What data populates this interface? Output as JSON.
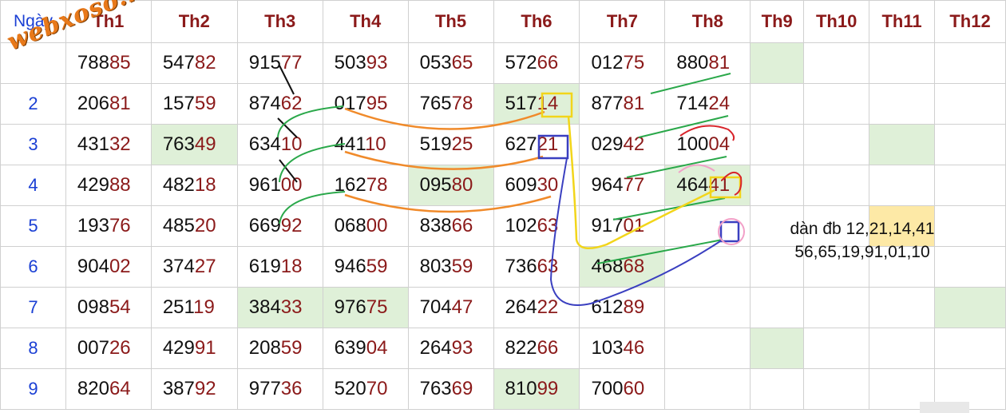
{
  "watermark": "webxoso.net",
  "header": {
    "day_label": "Ngày",
    "columns": [
      "Th1",
      "Th2",
      "Th3",
      "Th4",
      "Th5",
      "Th6",
      "Th7",
      "Th8",
      "Th9",
      "Th10",
      "Th11",
      "Th12"
    ]
  },
  "rows": [
    {
      "day": "",
      "cells": [
        [
          "788",
          "85"
        ],
        [
          "547",
          "82"
        ],
        [
          "915",
          "77"
        ],
        [
          "503",
          "93"
        ],
        [
          "053",
          "65"
        ],
        [
          "572",
          "66"
        ],
        [
          "012",
          "75"
        ],
        [
          "880",
          "81"
        ],
        null,
        null,
        null,
        null
      ]
    },
    {
      "day": "2",
      "cells": [
        [
          "206",
          "81"
        ],
        [
          "157",
          "59"
        ],
        [
          "874",
          "62"
        ],
        [
          "017",
          "95"
        ],
        [
          "765",
          "78"
        ],
        [
          "517",
          "14"
        ],
        [
          "877",
          "81"
        ],
        [
          "714",
          "24"
        ],
        null,
        null,
        null,
        null
      ]
    },
    {
      "day": "3",
      "cells": [
        [
          "431",
          "32"
        ],
        [
          "763",
          "49"
        ],
        [
          "634",
          "10"
        ],
        [
          "441",
          "10"
        ],
        [
          "519",
          "25"
        ],
        [
          "627",
          "21"
        ],
        [
          "029",
          "42"
        ],
        [
          "100",
          "04"
        ],
        null,
        null,
        null,
        null
      ]
    },
    {
      "day": "4",
      "cells": [
        [
          "429",
          "88"
        ],
        [
          "482",
          "18"
        ],
        [
          "961",
          "00"
        ],
        [
          "162",
          "78"
        ],
        [
          "095",
          "80"
        ],
        [
          "609",
          "30"
        ],
        [
          "964",
          "77"
        ],
        [
          "464",
          "41"
        ],
        null,
        null,
        null,
        null
      ]
    },
    {
      "day": "5",
      "cells": [
        [
          "193",
          "76"
        ],
        [
          "485",
          "20"
        ],
        [
          "669",
          "92"
        ],
        [
          "068",
          "00"
        ],
        [
          "838",
          "66"
        ],
        [
          "102",
          "63"
        ],
        [
          "917",
          "01"
        ],
        null,
        null,
        null,
        null,
        null
      ]
    },
    {
      "day": "6",
      "cells": [
        [
          "904",
          "02"
        ],
        [
          "374",
          "27"
        ],
        [
          "619",
          "18"
        ],
        [
          "946",
          "59"
        ],
        [
          "803",
          "59"
        ],
        [
          "736",
          "63"
        ],
        [
          "468",
          "68"
        ],
        null,
        null,
        null,
        null,
        null
      ]
    },
    {
      "day": "7",
      "cells": [
        [
          "098",
          "54"
        ],
        [
          "251",
          "19"
        ],
        [
          "384",
          "33"
        ],
        [
          "976",
          "75"
        ],
        [
          "704",
          "47"
        ],
        [
          "264",
          "22"
        ],
        [
          "612",
          "89"
        ],
        null,
        null,
        null,
        null,
        null
      ]
    },
    {
      "day": "8",
      "cells": [
        [
          "007",
          "26"
        ],
        [
          "429",
          "91"
        ],
        [
          "208",
          "59"
        ],
        [
          "639",
          "04"
        ],
        [
          "264",
          "93"
        ],
        [
          "822",
          "66"
        ],
        [
          "103",
          "46"
        ],
        null,
        null,
        null,
        null,
        null
      ]
    },
    {
      "day": "9",
      "cells": [
        [
          "820",
          "64"
        ],
        [
          "387",
          "92"
        ],
        [
          "977",
          "36"
        ],
        [
          "520",
          "70"
        ],
        [
          "763",
          "69"
        ],
        [
          "810",
          "99"
        ],
        [
          "700",
          "60"
        ],
        null,
        null,
        null,
        null,
        null
      ]
    }
  ],
  "highlight_cells": [
    [
      0,
      8
    ],
    [
      1,
      5
    ],
    [
      2,
      1
    ],
    [
      2,
      10
    ],
    [
      3,
      4
    ],
    [
      3,
      7
    ],
    [
      5,
      6
    ],
    [
      6,
      2
    ],
    [
      6,
      3
    ],
    [
      6,
      11
    ],
    [
      7,
      8
    ],
    [
      8,
      5
    ]
  ],
  "highlight_color": "#dff0d8",
  "note_cells_color": "#fde9a6",
  "note": {
    "line1": "dàn đb 12,21,14,41",
    "line2": "56,65,19,91,01,10"
  },
  "colors": {
    "day": "#1a3fd4",
    "header": "#8b1a1a",
    "tail": "#8b1a1a"
  }
}
